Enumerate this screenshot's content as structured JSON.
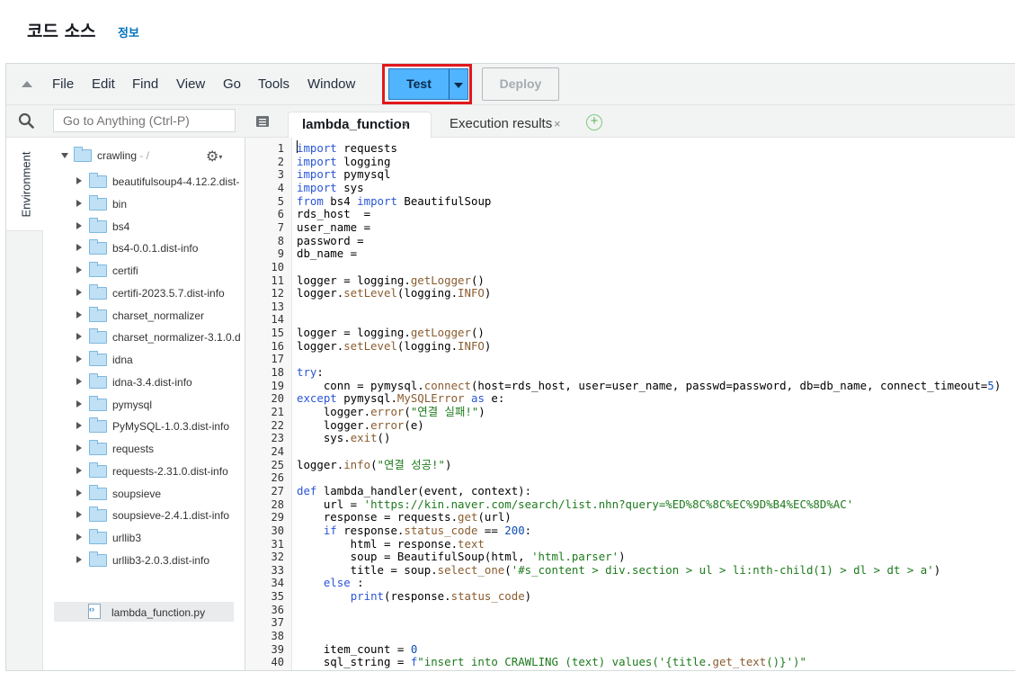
{
  "header": {
    "title": "코드 소스",
    "info_link": "정보"
  },
  "menu": {
    "items": [
      "File",
      "Edit",
      "Find",
      "View",
      "Go",
      "Tools",
      "Window"
    ],
    "test_label": "Test",
    "deploy_label": "Deploy"
  },
  "sidebar": {
    "search_placeholder": "Go to Anything (Ctrl-P)",
    "environment_tab": "Environment",
    "root": {
      "name": "crawling",
      "suffix": " - /"
    },
    "items": [
      "beautifulsoup4-4.12.2.dist-info",
      "bin",
      "bs4",
      "bs4-0.0.1.dist-info",
      "certifi",
      "certifi-2023.5.7.dist-info",
      "charset_normalizer",
      "charset_normalizer-3.1.0.dist-info",
      "idna",
      "idna-3.4.dist-info",
      "pymysql",
      "PyMySQL-1.0.3.dist-info",
      "requests",
      "requests-2.31.0.dist-info",
      "soupsieve",
      "soupsieve-2.4.1.dist-info",
      "urllib3",
      "urllib3-2.0.3.dist-info"
    ],
    "file": "lambda_function.py"
  },
  "editor": {
    "tabs": [
      {
        "label": "lambda_function"
      },
      {
        "label": "Execution results"
      }
    ],
    "close_glyph": "×",
    "add_glyph": "+",
    "code_lines": [
      "<span class='kw'>import</span> requests",
      "<span class='kw'>import</span> logging",
      "<span class='kw'>import</span> pymysql",
      "<span class='kw'>import</span> sys",
      "<span class='kw'>from</span> bs4 <span class='kw'>import</span> BeautifulSoup",
      "rds_host  =",
      "user_name =",
      "password =",
      "db_name =",
      "",
      "logger = logging.<span class='fn'>getLogger</span>()",
      "logger.<span class='fn'>setLevel</span>(logging.<span class='const'>INFO</span>)",
      "",
      "",
      "logger = logging.<span class='fn'>getLogger</span>()",
      "logger.<span class='fn'>setLevel</span>(logging.<span class='const'>INFO</span>)",
      "",
      "<span class='kw'>try</span>:",
      "    conn = pymysql.<span class='fn'>connect</span>(host=rds_host, user=user_name, passwd=password, db=db_name, connect_timeout=<span class='num'>5</span>)",
      "<span class='kw'>except</span> pymysql.<span class='fn'>MySQLError</span> <span class='kw'>as</span> e:",
      "    logger.<span class='fn'>error</span>(<span class='str'>\"연결 실패!\"</span>)",
      "    logger.<span class='fn'>error</span>(e)",
      "    sys.<span class='fn'>exit</span>()",
      "",
      "logger.<span class='fn'>info</span>(<span class='str'>\"연결 성공!\"</span>)",
      "",
      "<span class='kw'>def</span> lambda_handler(event, context):",
      "    url = <span class='str'>'https://kin.naver.com/search/list.nhn?query=%ED%8C%8C%EC%9D%B4%EC%8D%AC'</span>",
      "    response = requests.<span class='fn'>get</span>(url)",
      "    <span class='kw'>if</span> response.<span class='fn'>status_code</span> == <span class='num'>200</span>:",
      "        html = response.<span class='fn'>text</span>",
      "        soup = BeautifulSoup(html, <span class='str'>'html.parser'</span>)",
      "        title = soup.<span class='fn'>select_one</span>(<span class='str'>'#s_content &gt; div.section &gt; ul &gt; li:nth-child(1) &gt; dl &gt; dt &gt; a'</span>)",
      "    <span class='kw'>else</span> :",
      "        <span class='kw'>print</span>(response.<span class='fn'>status_code</span>)",
      "",
      "",
      "",
      "    item_count = <span class='num'>0</span>",
      "    sql_string = <span class='kw'>f</span><span class='str'>\"insert into CRAWLING (text) values('{title.</span><span class='fn'>get_text</span><span class='str'>()}')\"</span>"
    ]
  }
}
